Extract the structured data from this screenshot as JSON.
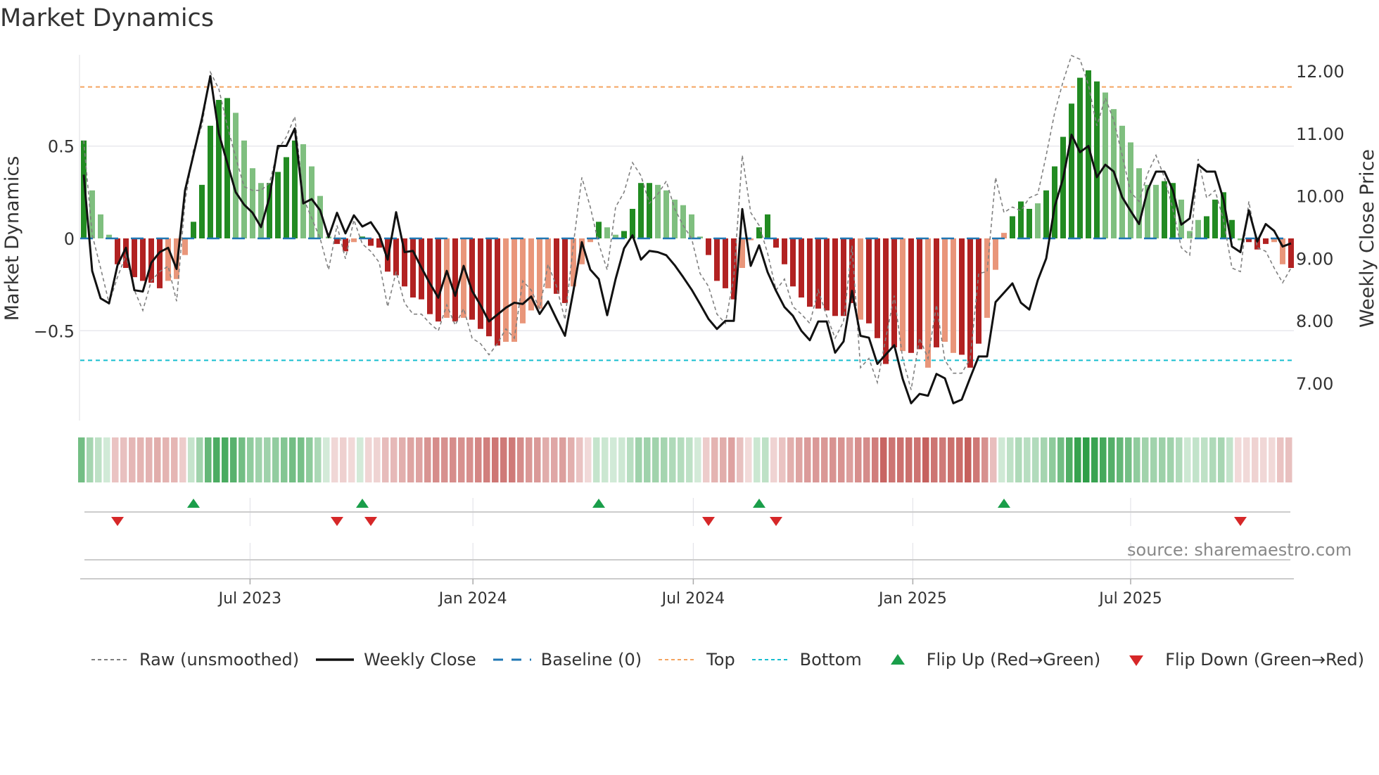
{
  "title": "Market Dynamics",
  "source": "source: sharemaestro.com",
  "colors": {
    "strong_up": "#228b22",
    "weak_up": "#7fbf7f",
    "strong_down": "#b22222",
    "weak_down": "#e9967a",
    "raw": "#808080",
    "close": "#111111",
    "baseline": "#1f77b4",
    "top": "#f4a460",
    "bottom": "#17becf",
    "flip_up": "#1a9e4a",
    "flip_down": "#d62728",
    "strip_up": "#2e9e48",
    "strip_down": "#c0504d"
  },
  "chart_data": {
    "type": "bar",
    "title": "Market Dynamics",
    "ylabel": "Market Dynamics",
    "y2label": "Weekly Close Price",
    "ylim": [
      -0.99,
      1.02
    ],
    "y2lim": [
      6.3,
      12.25
    ],
    "yticks": [
      {
        "value": 0.5,
        "label": "0.5"
      },
      {
        "value": 0,
        "label": "0"
      },
      {
        "value": -0.5,
        "label": "−0.5"
      }
    ],
    "y2ticks": [
      {
        "value": 12,
        "label": "12.00"
      },
      {
        "value": 11,
        "label": "11.00"
      },
      {
        "value": 10,
        "label": "10.00"
      },
      {
        "value": 9,
        "label": "9.00"
      },
      {
        "value": 8,
        "label": "8.00"
      },
      {
        "value": 7,
        "label": "7.00"
      }
    ],
    "xticks": [
      {
        "week": 20.7,
        "label": "Jul 2023"
      },
      {
        "week": 47.1,
        "label": "Jan 2024"
      },
      {
        "week": 73.2,
        "label": "Jul 2024"
      },
      {
        "week": 99.2,
        "label": "Jan 2025"
      },
      {
        "week": 125.0,
        "label": "Jul 2025"
      }
    ],
    "top": 0.82,
    "bottom": -0.66,
    "baseline": 0,
    "dynamics": [
      0.53,
      0.26,
      0.13,
      0.02,
      -0.14,
      -0.16,
      -0.21,
      -0.23,
      -0.24,
      -0.27,
      -0.23,
      -0.22,
      -0.09,
      0.09,
      0.29,
      0.61,
      0.75,
      0.76,
      0.68,
      0.53,
      0.38,
      0.3,
      0.3,
      0.36,
      0.44,
      0.53,
      0.51,
      0.39,
      0.23,
      0.01,
      -0.03,
      -0.07,
      -0.02,
      0.01,
      -0.04,
      -0.05,
      -0.18,
      -0.2,
      -0.26,
      -0.32,
      -0.33,
      -0.41,
      -0.45,
      -0.43,
      -0.45,
      -0.43,
      -0.44,
      -0.49,
      -0.53,
      -0.58,
      -0.56,
      -0.56,
      -0.46,
      -0.39,
      -0.38,
      -0.27,
      -0.3,
      -0.35,
      -0.26,
      -0.14,
      -0.02,
      0.09,
      0.06,
      0.02,
      0.04,
      0.16,
      0.3,
      0.3,
      0.29,
      0.26,
      0.21,
      0.18,
      0.13,
      0.01,
      -0.09,
      -0.23,
      -0.27,
      -0.33,
      -0.16,
      -0.01,
      0.06,
      0.13,
      -0.05,
      -0.14,
      -0.26,
      -0.32,
      -0.37,
      -0.38,
      -0.39,
      -0.42,
      -0.42,
      -0.35,
      -0.44,
      -0.46,
      -0.54,
      -0.68,
      -0.59,
      -0.61,
      -0.62,
      -0.6,
      -0.7,
      -0.59,
      -0.56,
      -0.62,
      -0.63,
      -0.7,
      -0.57,
      -0.43,
      -0.17,
      0.03,
      0.12,
      0.2,
      0.16,
      0.19,
      0.26,
      0.39,
      0.55,
      0.73,
      0.87,
      0.91,
      0.85,
      0.79,
      0.7,
      0.61,
      0.52,
      0.38,
      0.29,
      0.29,
      0.31,
      0.3,
      0.21,
      0.04,
      0.1,
      0.12,
      0.21,
      0.25,
      0.1,
      -0.01,
      -0.02,
      -0.06,
      -0.03,
      -0.02,
      -0.14,
      -0.16
    ],
    "shade": "Gggg RRRRRRrrrGGGGGggggGGGGgggg RRrGRRRRRRRRRrRrRRRRrrrrrrRRrrrGggGGGGgggggg RRRRrrGGRRRRRRRRRRrRRRRrRRrRrrRRRrrrGGGgGGGGGGGgggggggGGgggGGGGgRRRrrRR",
    "raw": [
      0.53,
      0.02,
      -0.16,
      -0.35,
      -0.21,
      -0.09,
      -0.28,
      -0.39,
      -0.23,
      -0.18,
      -0.15,
      -0.34,
      0.2,
      0.48,
      0.61,
      0.9,
      0.81,
      0.61,
      0.44,
      0.28,
      0.26,
      0.26,
      0.3,
      0.48,
      0.55,
      0.66,
      0.22,
      0.11,
      0.0,
      -0.17,
      0.07,
      -0.11,
      0.1,
      -0.03,
      -0.07,
      -0.13,
      -0.37,
      -0.18,
      -0.35,
      -0.41,
      -0.41,
      -0.46,
      -0.5,
      -0.36,
      -0.47,
      -0.38,
      -0.54,
      -0.57,
      -0.63,
      -0.57,
      -0.49,
      -0.54,
      -0.23,
      -0.28,
      -0.38,
      -0.14,
      -0.26,
      -0.44,
      -0.03,
      0.33,
      0.17,
      -0.03,
      -0.17,
      0.17,
      0.25,
      0.41,
      0.34,
      0.19,
      0.24,
      0.31,
      0.16,
      0.07,
      0.0,
      -0.19,
      -0.26,
      -0.41,
      -0.46,
      -0.21,
      0.45,
      0.14,
      0.07,
      -0.08,
      -0.28,
      -0.22,
      -0.37,
      -0.41,
      -0.46,
      -0.28,
      -0.42,
      -0.54,
      -0.45,
      -0.04,
      -0.7,
      -0.65,
      -0.78,
      -0.54,
      -0.31,
      -0.65,
      -0.82,
      -0.54,
      -0.65,
      -0.36,
      -0.66,
      -0.73,
      -0.73,
      -0.65,
      -0.19,
      -0.18,
      0.33,
      0.14,
      0.17,
      0.15,
      0.22,
      0.24,
      0.45,
      0.68,
      0.85,
      0.99,
      0.97,
      0.83,
      0.61,
      0.76,
      0.64,
      0.45,
      0.25,
      0.2,
      0.35,
      0.45,
      0.33,
      0.16,
      -0.05,
      -0.09,
      0.43,
      0.22,
      0.26,
      0.1,
      -0.16,
      -0.18,
      0.2,
      -0.05,
      -0.07,
      -0.16,
      -0.24,
      -0.16
    ],
    "weekly_close": [
      10.34,
      8.8,
      8.36,
      8.28,
      8.89,
      9.17,
      8.49,
      8.47,
      8.93,
      9.1,
      9.17,
      8.83,
      10.09,
      10.66,
      11.24,
      11.92,
      11.0,
      10.53,
      10.06,
      9.86,
      9.73,
      9.5,
      9.98,
      10.8,
      10.8,
      11.08,
      9.88,
      9.95,
      9.77,
      9.34,
      9.73,
      9.4,
      9.69,
      9.51,
      9.58,
      9.38,
      8.98,
      9.74,
      9.1,
      9.12,
      8.85,
      8.6,
      8.37,
      8.8,
      8.4,
      8.88,
      8.48,
      8.25,
      7.99,
      8.1,
      8.21,
      8.29,
      8.27,
      8.39,
      8.11,
      8.31,
      8.03,
      7.76,
      8.48,
      9.26,
      8.82,
      8.67,
      8.09,
      8.67,
      9.16,
      9.37,
      8.98,
      9.12,
      9.1,
      9.05,
      8.89,
      8.7,
      8.5,
      8.27,
      8.03,
      7.87,
      8.0,
      8.0,
      9.79,
      8.88,
      9.21,
      8.78,
      8.48,
      8.22,
      8.08,
      7.84,
      7.69,
      7.99,
      7.99,
      7.49,
      7.67,
      8.48,
      7.76,
      7.73,
      7.31,
      7.46,
      7.61,
      7.07,
      6.68,
      6.83,
      6.8,
      7.15,
      7.08,
      6.68,
      6.74,
      7.09,
      7.43,
      7.43,
      8.3,
      8.45,
      8.6,
      8.29,
      8.18,
      8.65,
      9.0,
      9.83,
      10.28,
      10.98,
      10.7,
      10.8,
      10.3,
      10.5,
      10.39,
      9.98,
      9.76,
      9.55,
      10.09,
      10.39,
      10.39,
      10.09,
      9.54,
      9.64,
      10.5,
      10.39,
      10.39,
      9.94,
      9.19,
      9.1,
      9.77,
      9.27,
      9.55,
      9.44,
      9.19,
      9.24
    ],
    "flip_up_weeks": [
      14,
      34,
      62,
      81,
      110
    ],
    "flip_down_weeks": [
      5,
      31,
      35,
      75,
      83,
      138
    ],
    "legend": [
      {
        "key": "raw",
        "label": "Raw (unsmoothed)"
      },
      {
        "key": "close",
        "label": "Weekly Close"
      },
      {
        "key": "baseline",
        "label": "Baseline (0)"
      },
      {
        "key": "top",
        "label": "Top"
      },
      {
        "key": "bottom",
        "label": "Bottom"
      },
      {
        "key": "flip_up",
        "label": "Flip Up (Red→Green)"
      },
      {
        "key": "flip_down",
        "label": "Flip Down (Green→Red)"
      }
    ],
    "legend_position": "bottom"
  }
}
